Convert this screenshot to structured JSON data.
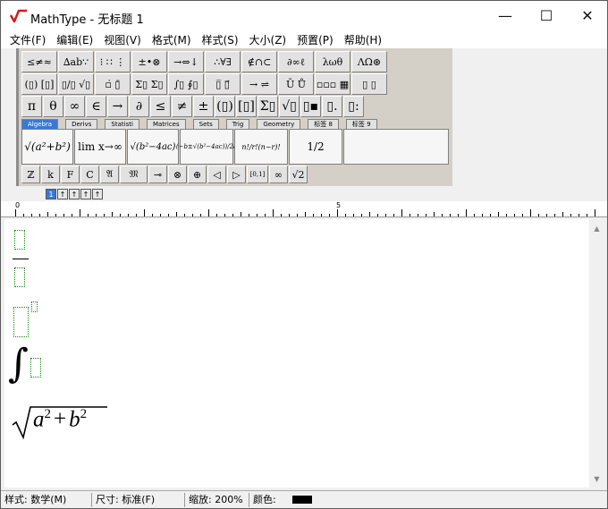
{
  "window": {
    "title": "MathType - 无标题 1",
    "controls": {
      "minimize": "—",
      "maximize": "☐",
      "close": "✕"
    }
  },
  "menu": [
    "文件(F)",
    "编辑(E)",
    "视图(V)",
    "格式(M)",
    "样式(S)",
    "大小(Z)",
    "预置(P)",
    "帮助(H)"
  ],
  "palette": {
    "row1": [
      "≤≠≈",
      "∆ab∵",
      "⁝ ∷ ⋮",
      "±•⊗",
      "→⇔↓",
      "∴∀∃",
      "∉∩⊂",
      "∂∞ℓ",
      "λωθ",
      "ΛΩ⊛"
    ],
    "row2": [
      "(▯) [▯]",
      "▯/▯ √▯",
      "▫̇ ▯̄",
      "Σ▯ Σ▯",
      "∫▯ ∮▯",
      "▯̅ ▯⃗",
      "→ ⇌",
      "Ū Ů",
      "▫▫▫ ▦",
      "▯ ▯"
    ],
    "row3": [
      "π",
      "θ",
      "∞",
      "∈",
      "→",
      "∂",
      "≤",
      "≠",
      "±",
      "(▯)",
      "[▯]",
      "Σ▯",
      "√▯",
      "▯▪",
      "▯.",
      "▯:"
    ],
    "tabs": [
      "Algebra",
      "Derivs",
      "Statisti",
      "Matrices",
      "Sets",
      "Trig",
      "Geometry",
      "标签 8",
      "标签 9"
    ],
    "templates": [
      "√(a²+b²)",
      "lim x→∞",
      "√(b²−4ac)",
      "(−b±√(b²−4ac))/2a",
      "n!/r!(n−r)!",
      "1/2"
    ],
    "row5": [
      "ℤ",
      "k",
      "F",
      "C",
      "𝔄",
      "𝔐",
      "⊸",
      "⊗",
      "⊕",
      "◁",
      "▷",
      "[0,1]",
      "∞",
      "√2"
    ]
  },
  "minibar": [
    "1",
    "↑",
    "↑",
    "↑",
    "↑"
  ],
  "ruler": {
    "labels": [
      "0",
      "5"
    ]
  },
  "editor": {
    "sqrt_expression": {
      "a": "a",
      "exp1": "2",
      "plus": "+",
      "b": "b",
      "exp2": "2"
    },
    "integral_symbol": "∫"
  },
  "status": {
    "style": "样式: 数学(M)",
    "size": "尺寸: 标准(F)",
    "zoom": "缩放: 200%",
    "color_label": "颜色:",
    "color": "#000000"
  }
}
